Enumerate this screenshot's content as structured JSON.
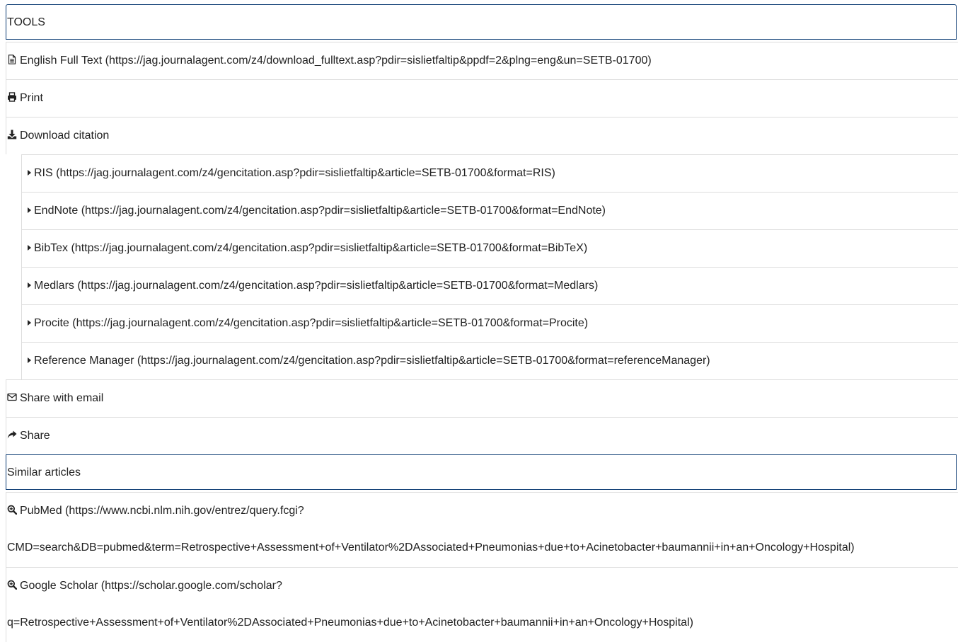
{
  "tools": {
    "header": "TOOLS",
    "full_text": "English Full Text (https://jag.journalagent.com/z4/download_fulltext.asp?pdir=sislietfaltip&ppdf=2&plng=eng&un=SETB-01700)",
    "print": "Print",
    "download_citation": "Download citation",
    "citations": [
      "RIS (https://jag.journalagent.com/z4/gencitation.asp?pdir=sislietfaltip&article=SETB-01700&format=RIS)",
      "EndNote (https://jag.journalagent.com/z4/gencitation.asp?pdir=sislietfaltip&article=SETB-01700&format=EndNote)",
      "BibTex (https://jag.journalagent.com/z4/gencitation.asp?pdir=sislietfaltip&article=SETB-01700&format=BibTeX)",
      "Medlars (https://jag.journalagent.com/z4/gencitation.asp?pdir=sislietfaltip&article=SETB-01700&format=Medlars)",
      "Procite (https://jag.journalagent.com/z4/gencitation.asp?pdir=sislietfaltip&article=SETB-01700&format=Procite)",
      "Reference Manager (https://jag.journalagent.com/z4/gencitation.asp?pdir=sislietfaltip&article=SETB-01700&format=referenceManager)"
    ],
    "share_email": "Share with email",
    "share": "Share"
  },
  "similar": {
    "header": "Similar articles",
    "pubmed_line1": "PubMed (https://www.ncbi.nlm.nih.gov/entrez/query.fcgi?",
    "pubmed_line2": "CMD=search&DB=pubmed&term=Retrospective+Assessment+of+Ventilator%2DAssociated+Pneumonias+due+to+Acinetobacter+baumannii+in+an+Oncology+Hospital)",
    "scholar_line1": "Google Scholar (https://scholar.google.com/scholar?",
    "scholar_line2": "q=Retrospective+Assessment+of+Ventilator%2DAssociated+Pneumonias+due+to+Acinetobacter+baumannii+in+an+Oncology+Hospital)"
  },
  "icons": {
    "full_text": "file-text-icon",
    "print": "print-icon",
    "download": "download-icon",
    "citation_item": "caret-right-icon",
    "email": "envelope-icon",
    "share": "share-arrow-icon",
    "search": "search-plus-icon"
  },
  "colors": {
    "header_border": "#0b3b73",
    "row_border": "#dddddd",
    "text": "#222222"
  }
}
